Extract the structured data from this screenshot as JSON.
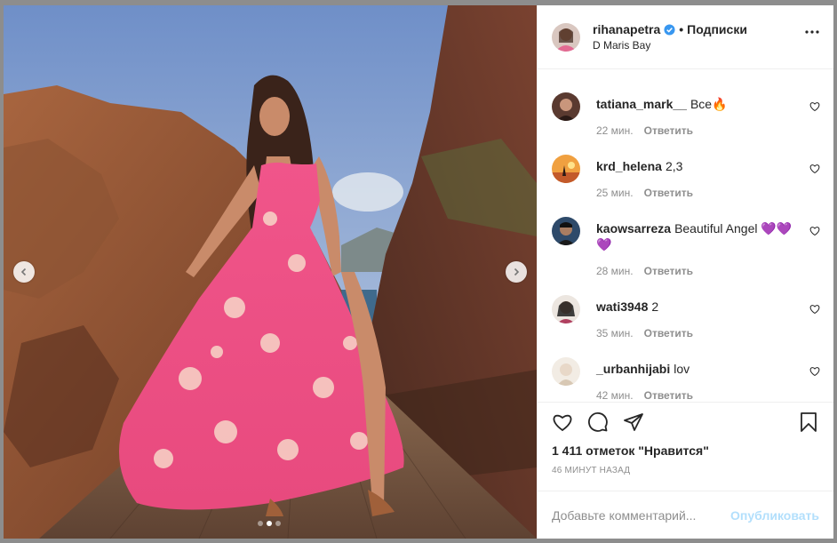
{
  "colors": {
    "accent": "#0095f6",
    "accent_disabled": "#b2dffc",
    "verified": "#3897f0",
    "text": "#262626",
    "muted": "#8e8e8e"
  },
  "post": {
    "author": {
      "username": "rihanapetra",
      "verified_icon": "verified-badge-icon",
      "follow_separator": "•",
      "follow_label": "Подписки",
      "location": "D Maris Bay"
    },
    "carousel": {
      "current_slide": 2,
      "total_slides": 3
    }
  },
  "comments": [
    {
      "username": "tatiana_mark__",
      "text": "Все🔥",
      "time": "22 мин.",
      "reply": "Ответить"
    },
    {
      "username": "krd_helena",
      "text": "2,3",
      "time": "25 мин.",
      "reply": "Ответить"
    },
    {
      "username": "kaowsarreza",
      "text": "Beautiful Angel 💜💜💜",
      "time": "28 мин.",
      "reply": "Ответить"
    },
    {
      "username": "wati3948",
      "text": "2",
      "time": "35 мин.",
      "reply": "Ответить"
    },
    {
      "username": "_urbanhijabi",
      "text": "lov",
      "time": "42 мин.",
      "reply": "Ответить"
    }
  ],
  "likes_text": "1 411 отметок \"Нравится\"",
  "time_ago": "46 МИНУТ НАЗАД",
  "add_comment": {
    "placeholder": "Добавьте комментарий...",
    "publish_label": "Опубликовать"
  }
}
